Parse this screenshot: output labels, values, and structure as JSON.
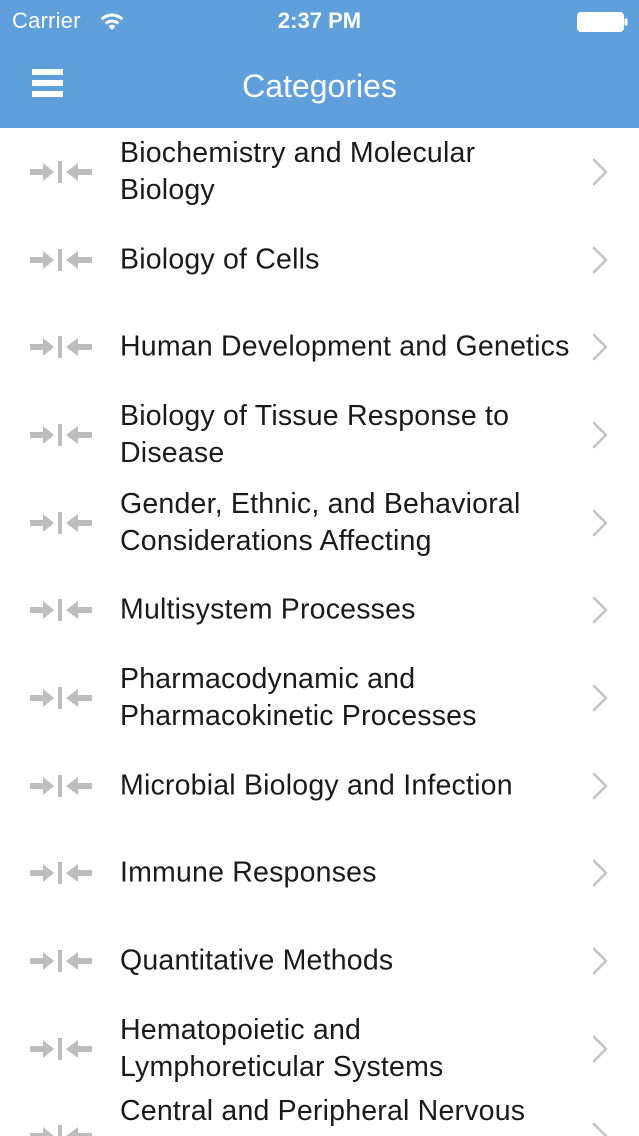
{
  "status_bar": {
    "carrier": "Carrier",
    "time": "2:37 PM"
  },
  "nav": {
    "title": "Categories"
  },
  "icons": {
    "row_leading": "collapse-arrows-icon",
    "row_trailing": "chevron-right-icon",
    "menu": "hamburger-menu-icon"
  },
  "colors": {
    "header": "#5e9fdc",
    "icon_gray": "#bdbdbd",
    "text": "#1a1a1a"
  },
  "categories": [
    {
      "label": "Biochemistry and Molecular Biology"
    },
    {
      "label": "Biology of Cells"
    },
    {
      "label": "Human Development and Genetics"
    },
    {
      "label": "Biology of Tissue Response to Disease"
    },
    {
      "label": "Gender, Ethnic, and Behavioral Considerations Affecting"
    },
    {
      "label": "Multisystem Processes"
    },
    {
      "label": "Pharmacodynamic and Pharmacokinetic Processes"
    },
    {
      "label": "Microbial Biology and Infection"
    },
    {
      "label": "Immune Responses"
    },
    {
      "label": "Quantitative Methods"
    },
    {
      "label": "Hematopoietic and Lymphoreticular Systems"
    },
    {
      "label": "Central and Peripheral Nervous"
    }
  ]
}
